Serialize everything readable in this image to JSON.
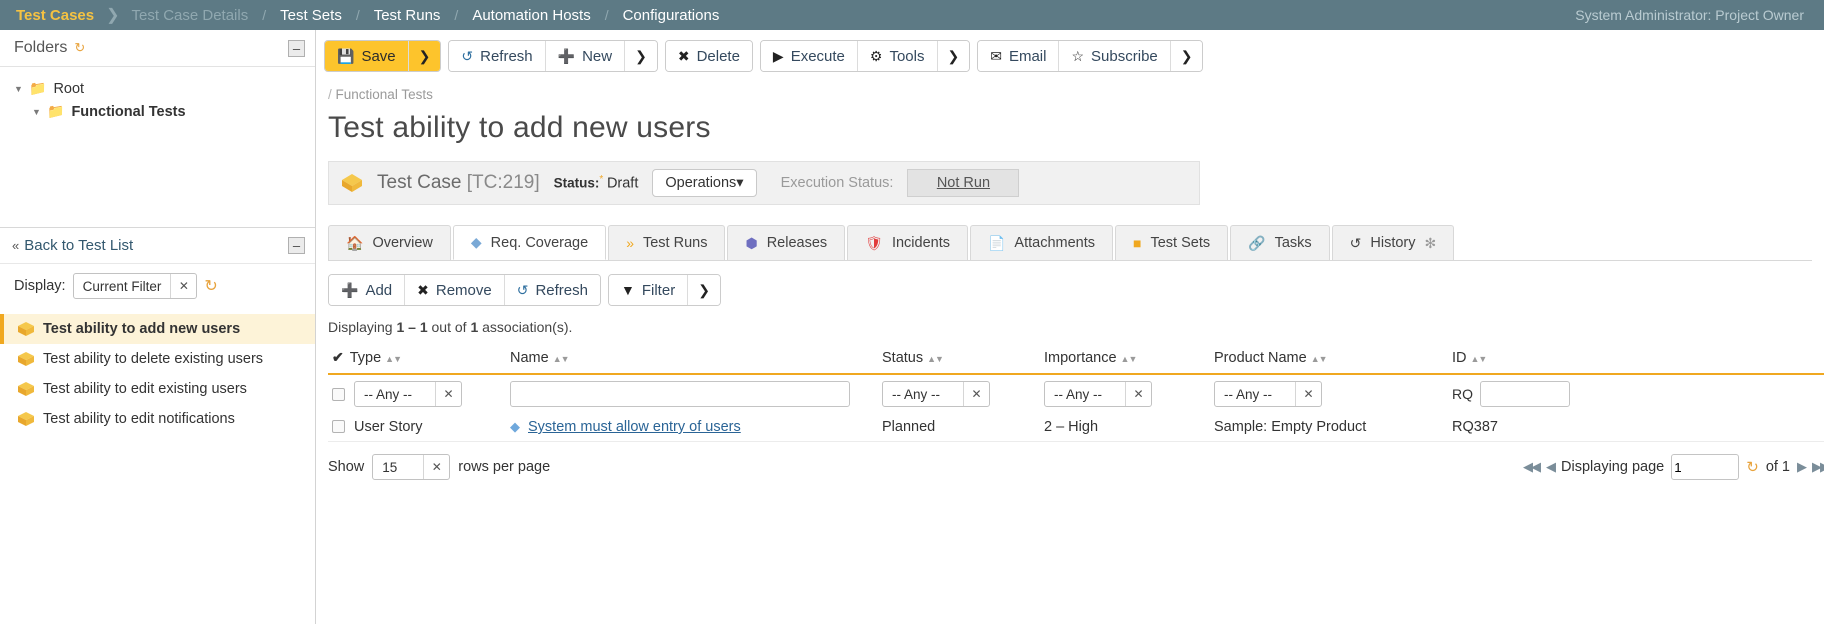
{
  "topbar": {
    "items": [
      {
        "label": "Test Cases",
        "state": "active"
      },
      {
        "label": "Test Case Details",
        "state": "dim"
      },
      {
        "label": "Test Sets",
        "state": "normal"
      },
      {
        "label": "Test Runs",
        "state": "normal"
      },
      {
        "label": "Automation Hosts",
        "state": "normal"
      },
      {
        "label": "Configurations",
        "state": "normal"
      }
    ],
    "user": "System Administrator: Project Owner"
  },
  "sidebar": {
    "folders_title": "Folders",
    "folders_refresh_icon": "refresh-icon",
    "collapse_label": "–",
    "tree": [
      {
        "label": "Root",
        "level": 1,
        "bold": false
      },
      {
        "label": "Functional Tests",
        "level": 2,
        "bold": true
      }
    ],
    "back_label": "Back to Test List",
    "display_label": "Display:",
    "display_value": "Current Filter",
    "sync_icon": "sync-icon",
    "test_list": [
      {
        "label": "Test ability to add new users",
        "selected": true
      },
      {
        "label": "Test ability to delete existing users",
        "selected": false
      },
      {
        "label": "Test ability to edit existing users",
        "selected": false
      },
      {
        "label": "Test ability to edit notifications",
        "selected": false
      }
    ]
  },
  "toolbar": {
    "save_label": "Save",
    "save_icon": "save-icon",
    "save_caret": "chevron-down-icon",
    "refresh_label": "Refresh",
    "refresh_icon": "refresh-icon",
    "new_label": "New",
    "new_icon": "plus-icon",
    "new_caret": "chevron-down-icon",
    "delete_label": "Delete",
    "delete_icon": "close-icon",
    "execute_label": "Execute",
    "execute_icon": "play-icon",
    "tools_label": "Tools",
    "tools_icon": "gear-icon",
    "tools_caret": "chevron-down-icon",
    "email_label": "Email",
    "email_icon": "envelope-icon",
    "subscribe_label": "Subscribe",
    "subscribe_icon": "star-icon",
    "subscribe_caret": "chevron-down-icon"
  },
  "header": {
    "breadcrumb_slash": "/",
    "breadcrumb": "Functional Tests",
    "title": "Test ability to add new users"
  },
  "status_panel": {
    "artifact_icon": "diamond-icon",
    "artifact_label": "Test Case",
    "artifact_id": "[TC:219]",
    "status_label": "Status:",
    "status_required": "*",
    "status_value": "Draft",
    "operations_label": "Operations",
    "operations_caret": "caret-down-icon",
    "execution_status_label": "Execution Status:",
    "execution_status_value": "Not Run"
  },
  "tabs": [
    {
      "label": "Overview",
      "icon": "home-icon",
      "active": false
    },
    {
      "label": "Req. Coverage",
      "icon": "diamond-icon",
      "active": true
    },
    {
      "label": "Test Runs",
      "icon": "chevrons-icon",
      "active": false
    },
    {
      "label": "Releases",
      "icon": "cube-icon",
      "active": false
    },
    {
      "label": "Incidents",
      "icon": "shield-icon",
      "active": false
    },
    {
      "label": "Attachments",
      "icon": "document-icon",
      "active": false
    },
    {
      "label": "Test Sets",
      "icon": "stack-icon",
      "active": false
    },
    {
      "label": "Tasks",
      "icon": "link-icon",
      "active": false
    },
    {
      "label": "History",
      "icon": "history-icon",
      "active": false,
      "suffix": "✻"
    }
  ],
  "grid_toolbar": {
    "add_label": "Add",
    "add_icon": "plus-icon",
    "remove_label": "Remove",
    "remove_icon": "close-icon",
    "refresh_label": "Refresh",
    "refresh_icon": "refresh-icon",
    "filter_label": "Filter",
    "filter_icon": "funnel-icon",
    "filter_caret": "chevron-down-icon"
  },
  "grid": {
    "displaying_prefix": "Displaying",
    "displaying_range": "1 – 1",
    "displaying_mid": "out of",
    "displaying_total": "1",
    "displaying_suffix": "association(s).",
    "columns": [
      {
        "label": "Type",
        "sort": true
      },
      {
        "label": "Name",
        "sort": true
      },
      {
        "label": "Status",
        "sort": true
      },
      {
        "label": "Importance",
        "sort": true
      },
      {
        "label": "Product Name",
        "sort": true
      },
      {
        "label": "ID",
        "sort": true
      }
    ],
    "filters": {
      "type": "-- Any --",
      "name": "",
      "status": "-- Any --",
      "importance": "-- Any --",
      "product_name": "-- Any --",
      "id_prefix": "RQ",
      "id": ""
    },
    "rows": [
      {
        "type": "User Story",
        "name": "System must allow entry of users",
        "status": "Planned",
        "importance": "2 – High",
        "product_name": "Sample: Empty Product",
        "id": "RQ387"
      }
    ]
  },
  "pager": {
    "show_label": "Show",
    "rows_per_page_value": "15",
    "rows_per_page_label": "rows per page",
    "first_icon": "first-page-icon",
    "prev_icon": "prev-page-icon",
    "displaying_page_label": "Displaying page",
    "page_value": "1",
    "refresh_icon": "refresh-icon",
    "of_label": "of 1",
    "next_icon": "next-page-icon",
    "last_icon": "last-page-icon"
  },
  "colors": {
    "topbar_bg": "#5d7a85",
    "accent_yellow": "#fdc42c",
    "accent_orange": "#f0a820",
    "link_blue": "#2a6496"
  }
}
